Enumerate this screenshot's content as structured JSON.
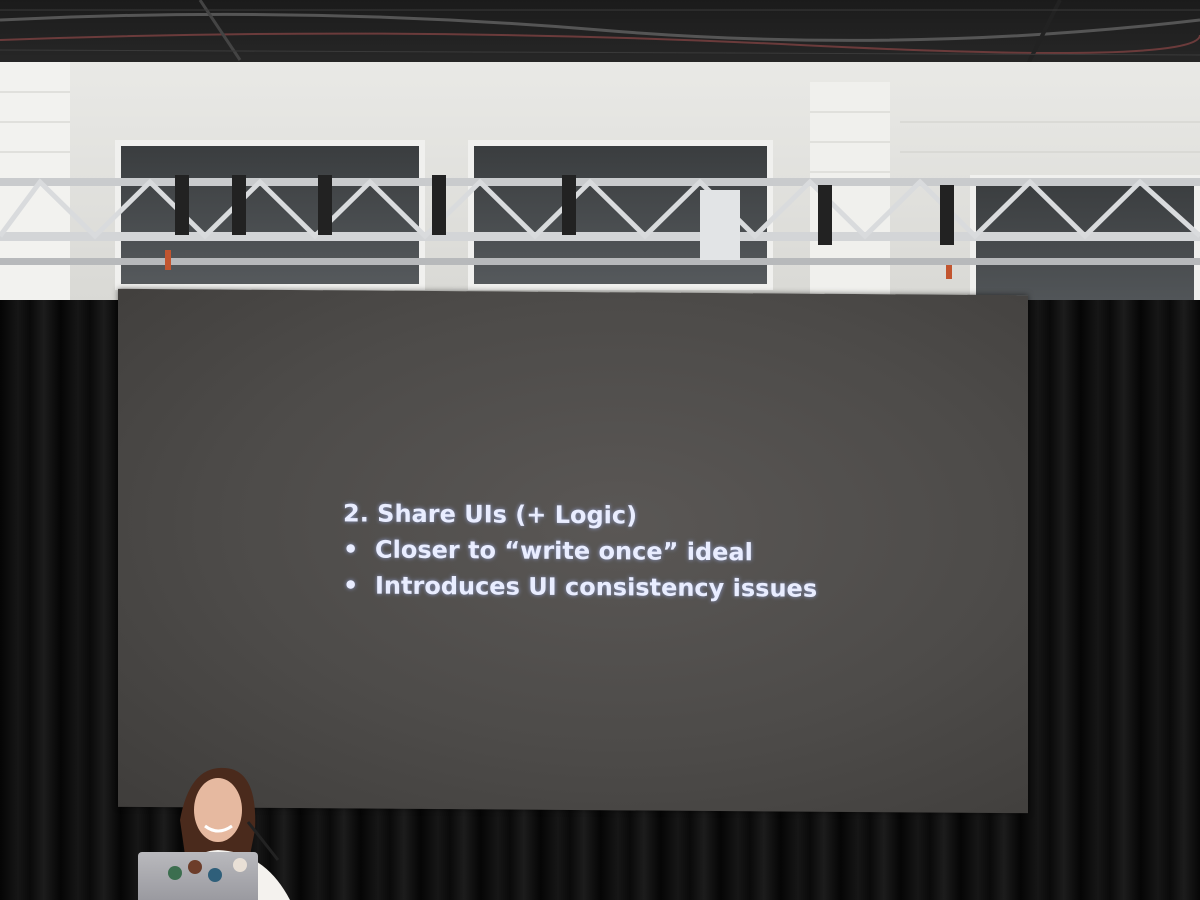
{
  "slide": {
    "heading": "2. Share UIs (+ Logic)",
    "bullets": [
      {
        "marker": "•",
        "text": "Closer to “write once” ideal"
      },
      {
        "marker": "•",
        "text": "Introduces UI consistency issues"
      }
    ]
  },
  "colors": {
    "slide_background": "#4d4b49",
    "slide_text": "#e9edff",
    "curtain": "#0a0a0a",
    "wall": "#e9e9e6"
  }
}
